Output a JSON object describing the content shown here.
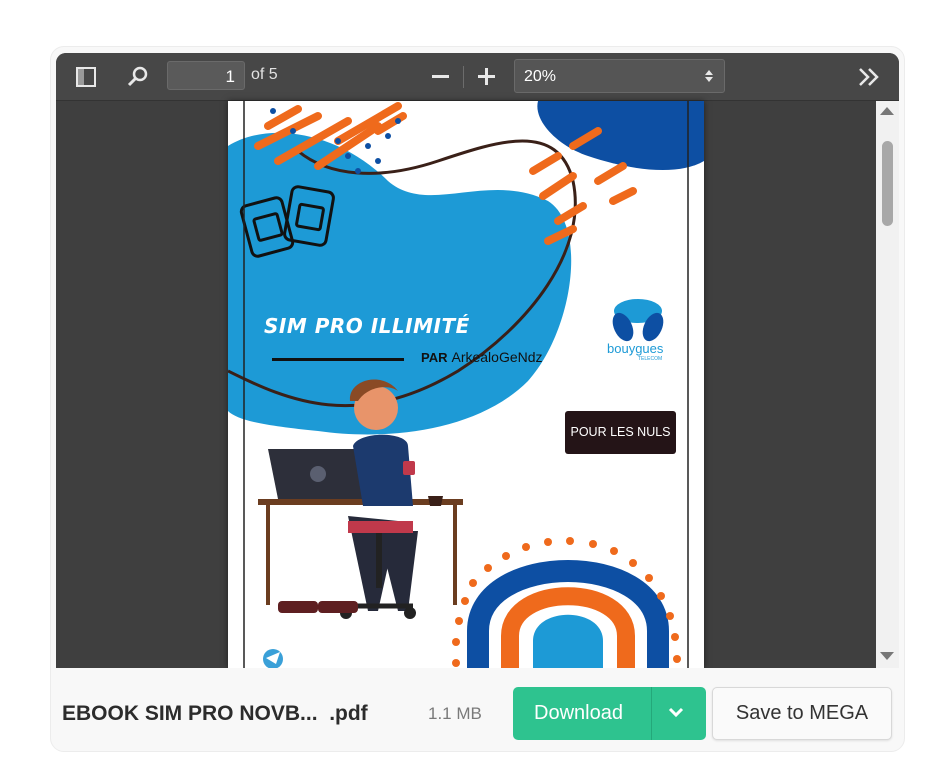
{
  "viewer": {
    "toolbar": {
      "page_number": "1",
      "page_total": "of 5",
      "zoom": "20%"
    },
    "cover": {
      "title": "SIM PRO ILLIMITÉ",
      "par_label": "PAR",
      "author": "ArkealoGeNdz",
      "badge": "POUR LES NULS",
      "brand": "bouygues",
      "brand_sub": "TELECOM"
    }
  },
  "file": {
    "name": "EBOOK SIM PRO NOVB...  .pdf",
    "size": "1.1 MB"
  },
  "actions": {
    "download_label": "Download",
    "save_label": "Save to MEGA"
  },
  "colors": {
    "download": "#2ec38f",
    "toolbar": "#474747",
    "cover_blue": "#1d9ad6",
    "cover_orange": "#ef6a1c"
  }
}
